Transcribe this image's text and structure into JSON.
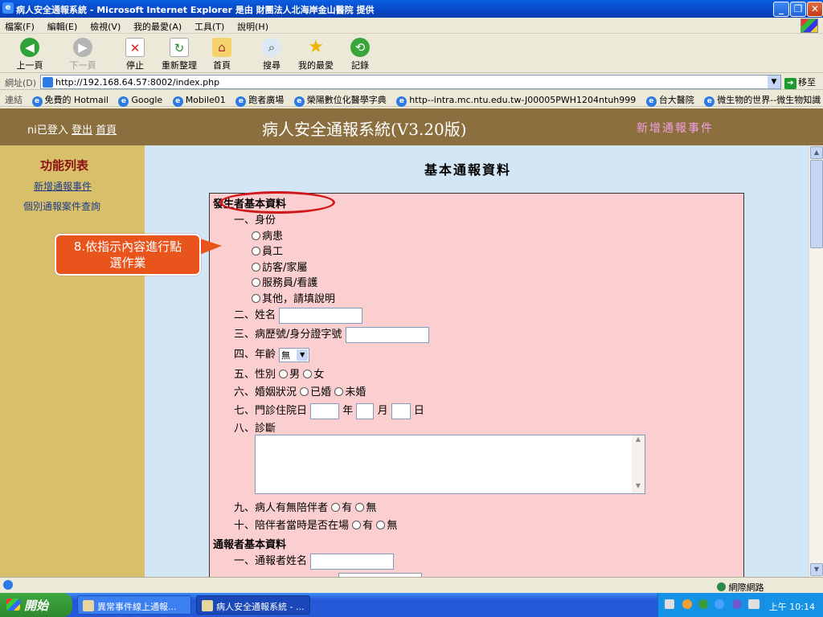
{
  "window": {
    "title": "病人安全通報系統 - Microsoft Internet Explorer 是由 財團法人北海岸金山醫院 提供"
  },
  "menu": [
    "檔案(F)",
    "編輯(E)",
    "檢視(V)",
    "我的最愛(A)",
    "工具(T)",
    "說明(H)"
  ],
  "toolbar": {
    "back": "上一頁",
    "forward": "下一頁",
    "stop": "停止",
    "refresh": "重新整理",
    "home": "首頁",
    "search": "搜尋",
    "favorites": "我的最愛",
    "history": "記錄"
  },
  "address": {
    "label": "網址(D)",
    "url": "http://192.168.64.57:8002/index.php",
    "go": "移至"
  },
  "links": {
    "label": "連結",
    "items": [
      "免費的 Hotmail",
      "Google",
      "Mobile01",
      "跑者廣場",
      "榮陽數位化醫學字典",
      "http--intra.mc.ntu.edu.tw-J00005PWH1204ntuh999",
      "台大醫院",
      "微生物的世界--微生物知識"
    ]
  },
  "header": {
    "user": "ni已登入",
    "logout": "登出",
    "home": "首頁",
    "title": "病人安全通報系統(V3.20版)",
    "page_name": "新增通報事件"
  },
  "sidebar": {
    "title": "功能列表",
    "new_event": "新增通報事件",
    "case_query": "個別通報案件查詢"
  },
  "callout": {
    "line1": "8.依指示內容進行點",
    "line2": "選作業"
  },
  "form": {
    "title": "基本通報資料",
    "section1": "發生者基本資料",
    "identity_label": "一、身份",
    "identity_options": [
      "病患",
      "員工",
      "訪客/家屬",
      "服務員/看護",
      "其他，請填說明"
    ],
    "name_label": "二、姓名",
    "id_label": "三、病歷號/身分證字號",
    "age_label": "四、年齡",
    "age_value": "無",
    "gender_label": "五、性別",
    "gender_male": "男",
    "gender_female": "女",
    "marital_label": "六、婚姻狀況",
    "marital_married": "已婚",
    "marital_single": "未婚",
    "visit_label": "七、門診住院日",
    "year": "年",
    "month": "月",
    "day": "日",
    "diagnosis_label": "八、診斷",
    "companion_label": "九、病人有無陪伴者",
    "companion_present_label": "十、陪伴者當時是否在場",
    "yes": "有",
    "no": "無",
    "section2": "通報者基本資料",
    "reporter_name_label": "一、通報者姓名"
  },
  "status": {
    "zone": "網際網路"
  },
  "taskbar": {
    "start": "開始",
    "task1": "異常事件線上通報...",
    "task2": "病人安全通報系統 - ...",
    "time": "上午 10:14"
  }
}
